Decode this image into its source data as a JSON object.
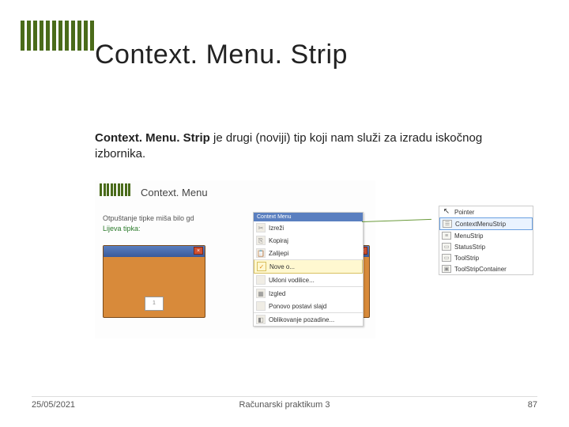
{
  "title": "Context. Menu. Strip",
  "body": {
    "bold": "Context. Menu. Strip",
    "rest": " je drugi (noviji) tip koji nam služi za izradu iskočnog izbornika."
  },
  "left_illustration": {
    "title": "Context. Menu",
    "desc_line1": "Otpuštanje tipke miša bilo gd",
    "desc_line2_green": "Lijeva tipka:",
    "context_menu": {
      "header": "Context Menu",
      "items": [
        "Izreži",
        "Kopiraj",
        "Zalijepi",
        "Nove o...",
        "Ukloni vodilice...",
        "Izgled",
        "Ponovo postavi slajd",
        "Oblikovanje pozadine..."
      ]
    }
  },
  "toolbox": {
    "items": [
      "Pointer",
      "ContextMenuStrip",
      "MenuStrip",
      "StatusStrip",
      "ToolStrip",
      "ToolStripContainer"
    ],
    "selected_index": 1
  },
  "footer": {
    "date": "25/05/2021",
    "center": "Računarski praktikum 3",
    "page": "87"
  }
}
